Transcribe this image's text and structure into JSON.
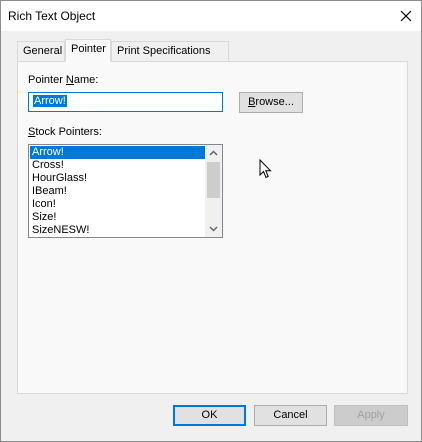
{
  "window": {
    "title": "Rich Text Object"
  },
  "tabs": [
    {
      "label": "General"
    },
    {
      "label": "Pointer"
    },
    {
      "label": "Print Specifications"
    }
  ],
  "pointer_name": {
    "label_pre": "Pointer ",
    "label_accel": "N",
    "label_post": "ame:",
    "value": "Arrow!"
  },
  "browse": {
    "pre": "",
    "accel": "B",
    "post": "rowse..."
  },
  "stock_pointers": {
    "label_accel": "S",
    "label_post": "tock Pointers:",
    "items": [
      "Arrow!",
      "Cross!",
      "HourGlass!",
      "IBeam!",
      "Icon!",
      "Size!",
      "SizeNESW!"
    ],
    "selected": "Arrow!"
  },
  "buttons": {
    "ok": "OK",
    "cancel": "Cancel",
    "apply": "Apply"
  },
  "colors": {
    "accent": "#0078d7"
  },
  "icons": {
    "close": "close-icon",
    "cursor": "mouse-cursor-icon"
  }
}
